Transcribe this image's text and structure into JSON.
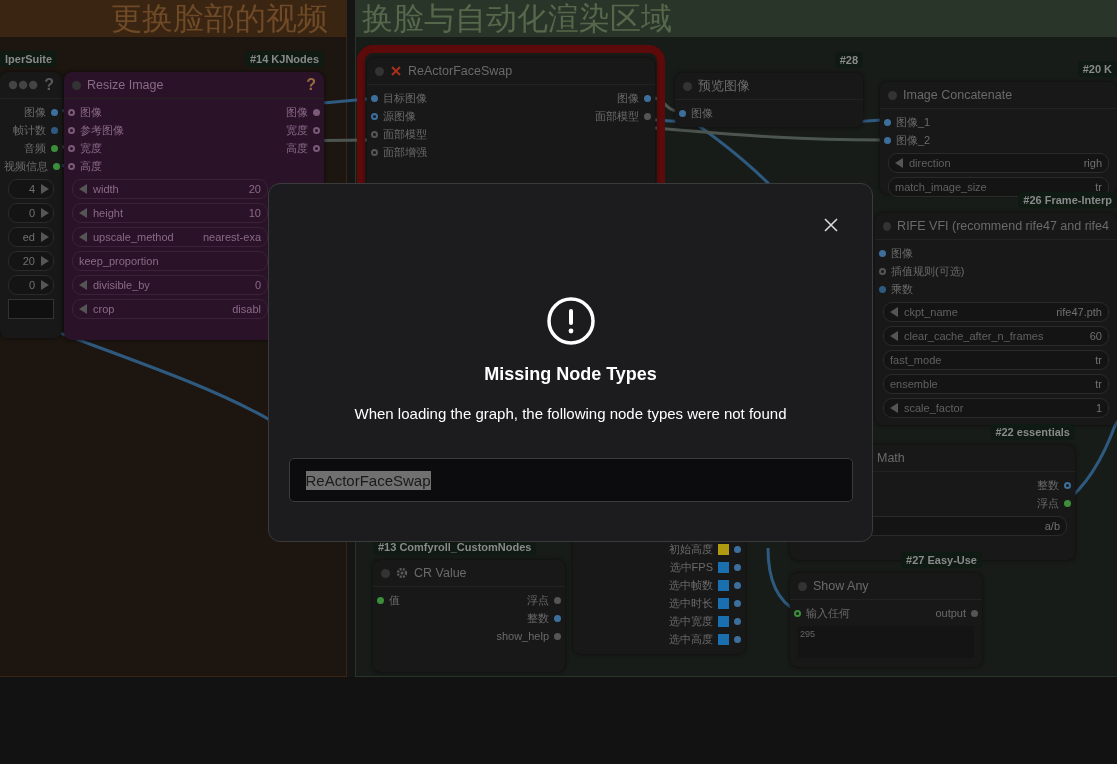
{
  "groups": [
    {
      "title": "更换脸部的视频",
      "color": "#3a2412"
    },
    {
      "title": "换脸与自动化渲染区域",
      "color": "#2a352a"
    }
  ],
  "nodes": [
    {
      "badge": "lperSuite",
      "help": "?",
      "outputs": [
        {
          "label": "图像",
          "color": "#3d6f9c",
          "connected": true
        },
        {
          "label": "帧计数",
          "color": "#2f5a80",
          "connected": true
        },
        {
          "label": "音频",
          "color": "#3b8f3b",
          "connected": true
        },
        {
          "label": "视频信息",
          "color": "#3b8f3b",
          "connected": true
        }
      ],
      "widgets": [
        {
          "value": "4",
          "arrows": true
        },
        {
          "value": "0",
          "arrows": true
        },
        {
          "value": "ed",
          "arrows": true
        },
        {
          "value": "20",
          "arrows": true
        },
        {
          "value": "0",
          "arrows": true
        }
      ],
      "field": true
    },
    {
      "badge": "#14 KJNodes",
      "title": "Resize Image",
      "help": "?",
      "inputs": [
        {
          "label": "图像",
          "color": "#7a5a78",
          "connected": false
        },
        {
          "label": "参考图像",
          "color": "#7a5a78",
          "connected": false
        },
        {
          "label": "宽度",
          "color": "#7a5a78",
          "connected": false
        },
        {
          "label": "高度",
          "color": "#7a5a78",
          "connected": false
        }
      ],
      "outputs": [
        {
          "label": "图像",
          "color": "#7a5a78",
          "connected": true
        },
        {
          "label": "宽度",
          "color": "#7a5a78",
          "connected": false
        },
        {
          "label": "高度",
          "color": "#7a5a78",
          "connected": false
        }
      ],
      "widgets": [
        {
          "label": "width",
          "value": "20",
          "arrows": true
        },
        {
          "label": "height",
          "value": "10",
          "arrows": true
        },
        {
          "label": "upscale_method",
          "value": "nearest-exa",
          "arrows": true
        },
        {
          "label": "keep_proportion",
          "arrows": false
        },
        {
          "label": "divisible_by",
          "value": "0",
          "arrows": true
        },
        {
          "label": "crop",
          "value": "disabl",
          "arrows": true
        }
      ]
    },
    {
      "title": "ReActorFaceSwap",
      "error": true,
      "inputs": [
        {
          "label": "目标图像",
          "color": "#3d6f9c",
          "connected": true
        },
        {
          "label": "源图像",
          "color": "#3d6f9c",
          "connected": false
        },
        {
          "label": "面部模型",
          "color": "#555555",
          "connected": false
        },
        {
          "label": "面部增强",
          "color": "#555555",
          "connected": false
        }
      ],
      "outputs": [
        {
          "label": "图像",
          "color": "#3d6f9c",
          "connected": true
        },
        {
          "label": "面部模型",
          "color": "#555555",
          "connected": true
        }
      ]
    },
    {
      "badge": "#28",
      "title": "预览图像",
      "inputs": [
        {
          "label": "图像",
          "color": "#3d6f9c",
          "connected": true
        }
      ]
    },
    {
      "badge": "#20 K",
      "title": "Image Concatenate",
      "inputs": [
        {
          "label": "图像_1",
          "color": "#3d6f9c",
          "connected": true
        },
        {
          "label": "图像_2",
          "color": "#3d6f9c",
          "connected": true
        }
      ],
      "widgets": [
        {
          "label": "direction",
          "value": "righ",
          "arrows": true
        },
        {
          "label": "match_image_size",
          "value": "tr",
          "arrows": false
        }
      ]
    },
    {
      "badge": "#26 Frame-Interp",
      "title": "RIFE VFI (recommend rife47 and rife4",
      "inputs": [
        {
          "label": "图像",
          "color": "#3d6f9c",
          "connected": true
        },
        {
          "label": "插值规则(可选)",
          "color": "#555555",
          "connected": false
        },
        {
          "label": "乘数",
          "color": "#2f5a80",
          "connected": true
        }
      ],
      "widgets": [
        {
          "label": "ckpt_name",
          "value": "rife47.pth",
          "arrows": true
        },
        {
          "label": "clear_cache_after_n_frames",
          "value": "60",
          "arrows": true
        },
        {
          "label": "fast_mode",
          "value": "tr",
          "arrows": false
        },
        {
          "label": "ensemble",
          "value": "tr",
          "arrows": false
        },
        {
          "label": "scale_factor",
          "value": "1",
          "arrows": true
        }
      ]
    },
    {
      "badge": "#22 essentials",
      "title": "Math",
      "outputs": [
        {
          "label": "整数",
          "color": "#3d6f9c",
          "connected": false
        },
        {
          "label": "浮点",
          "color": "#3b8f3b",
          "connected": true
        }
      ],
      "widgets": [
        {
          "value": "a/b",
          "arrows": false
        }
      ]
    },
    {
      "badge": "#13 Comfyroll_CustomNodes",
      "title": "CR Value",
      "inputs": [
        {
          "label": "值",
          "color": "#3b8f3b",
          "connected": true
        }
      ],
      "outputs": [
        {
          "label": "浮点",
          "color": "#555555",
          "connected": true
        },
        {
          "label": "整数",
          "color": "#3d6f9c",
          "connected": true
        },
        {
          "label": "show_help",
          "color": "#555555",
          "connected": true
        }
      ]
    },
    {
      "outputs": [
        {
          "label": "初始高度",
          "color": "#b09a10",
          "connected": true,
          "kind": "swatch"
        },
        {
          "label": "选中FPS",
          "color": "#1a6fb0",
          "connected": true,
          "kind": "swatch"
        },
        {
          "label": "选中帧数",
          "color": "#1a6fb0",
          "connected": true,
          "kind": "swatch"
        },
        {
          "label": "选中时长",
          "color": "#1a6fb0",
          "connected": true,
          "kind": "swatch"
        },
        {
          "label": "选中宽度",
          "color": "#1a6fb0",
          "connected": true,
          "kind": "swatch"
        },
        {
          "label": "选中高度",
          "color": "#1a6fb0",
          "connected": true,
          "kind": "swatch"
        }
      ]
    },
    {
      "badge": "#27 Easy-Use",
      "title": "Show Any",
      "inputs": [
        {
          "label": "输入任何",
          "color": "#3b8f3b",
          "connected": false
        }
      ],
      "outputs": [
        {
          "label": "output",
          "color": "#555555",
          "connected": true
        }
      ],
      "text": "295"
    }
  ],
  "dialog": {
    "title": "Missing Node Types",
    "message": "When loading the graph, the following node types were not found",
    "items": [
      {
        "label": "ReActorFaceSwap",
        "selected": true
      }
    ]
  }
}
